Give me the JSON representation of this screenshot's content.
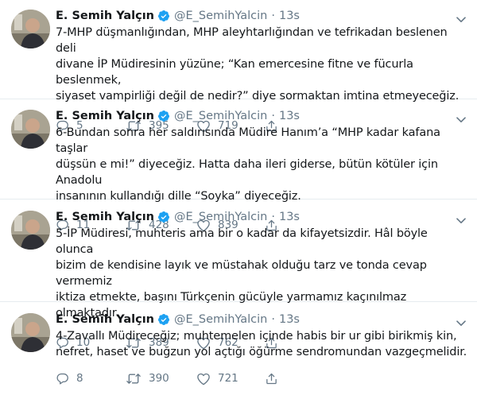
{
  "tweets": [
    {
      "author_name": "E. Semih Yalçın",
      "handle": "@E_SemihYalcin",
      "separator": "·",
      "time": "13s",
      "text": "7-MHP düşmanlığından, MHP aleyhtarlığından ve tefrikadan beslenen deli\ndivane İP Müdiresinin yüzüne; “Kan emercesine fitne ve fücurla beslenmek,\nsiyaset vampirliği değil de nedir?” diye sormaktan imtina etmeyeceğiz.",
      "replies": "5",
      "retweets": "395",
      "likes": "719"
    },
    {
      "author_name": "E. Semih Yalçın",
      "handle": "@E_SemihYalcin",
      "separator": "·",
      "time": "13s",
      "text": "6-Bundan sonra her saldırısında Müdire Hanım’a “MHP kadar kafana taşlar\ndüşsün e mi!” diyeceğiz. Hatta daha ileri giderse, bütün kötüler için Anadolu\ninsanının kullandığı dille “Soyka” diyeceğiz.",
      "replies": "11",
      "retweets": "428",
      "likes": "839"
    },
    {
      "author_name": "E. Semih Yalçın",
      "handle": "@E_SemihYalcin",
      "separator": "·",
      "time": "13s",
      "text": "5-İP Müdiresi, muhteris ama bir o kadar da kifayetsizdir. Hâl böyle olunca\nbizim de kendisine layık ve müstahak olduğu tarz ve tonda cevap vermemiz\niktiza etmekte, başını Türkçenin gücüyle yarmamız kaçınılmaz olmaktadır.",
      "replies": "10",
      "retweets": "389",
      "likes": "762"
    },
    {
      "author_name": "E. Semih Yalçın",
      "handle": "@E_SemihYalcin",
      "separator": "·",
      "time": "13s",
      "text": "4-Zavallı Müdireceğiz; muhtemelen içinde habis bir ur gibi birikmiş kin,\nnefret, haset ve buğzun yol açtığı öğürme sendromundan vazgeçmelidir.",
      "replies": "8",
      "retweets": "390",
      "likes": "721"
    }
  ],
  "icons": {
    "verified": "verified-badge-icon",
    "reply": "reply-icon",
    "retweet": "retweet-icon",
    "like": "heart-icon",
    "share": "share-icon",
    "more": "chevron-down-icon"
  },
  "colors": {
    "verified_blue": "#1da1f2",
    "muted_text": "#657786",
    "divider": "#e6ecf0",
    "primary_text": "#14171a"
  }
}
